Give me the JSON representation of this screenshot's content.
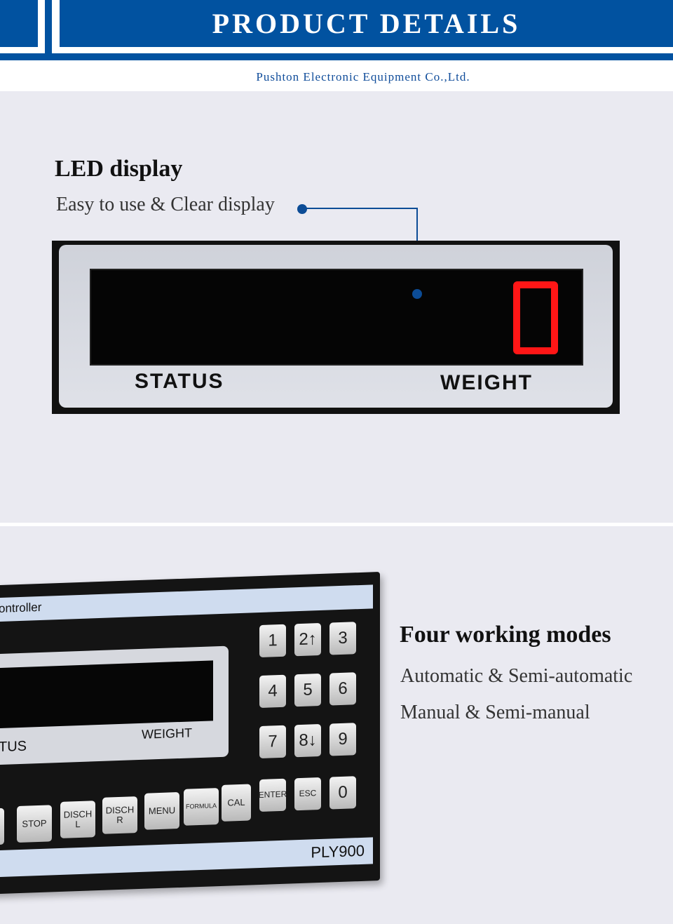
{
  "header": {
    "title": "PRODUCT DETAILS",
    "company": "Pushton Electronic Equipment Co.,Ltd."
  },
  "led": {
    "title": "LED display",
    "subtitle": "Easy to use & Clear display",
    "status_label": "STATUS",
    "weight_label": "WEIGHT",
    "digit": "0",
    "digit_color": "#ff1616"
  },
  "modes": {
    "title": "Four working modes",
    "line1": "Automatic & Semi-automatic",
    "line2": "Manual & Semi-manual"
  },
  "device": {
    "brand_partial": "ontroller",
    "status_partial": "TUS",
    "weight_label": "WEIGHT",
    "model": "PLY900",
    "num_keys": [
      "1",
      "2↑",
      "3",
      "4",
      "5",
      "6",
      "7",
      "8↓",
      "9",
      "ENTER",
      "ESC",
      "0"
    ],
    "func_keys": [
      "E",
      "STOP",
      "DISCH L",
      "DISCH R",
      "MENU",
      "FORMULA",
      "CAL"
    ]
  },
  "colors": {
    "brand_blue": "#0152a0",
    "background": "#eaeaf1"
  }
}
